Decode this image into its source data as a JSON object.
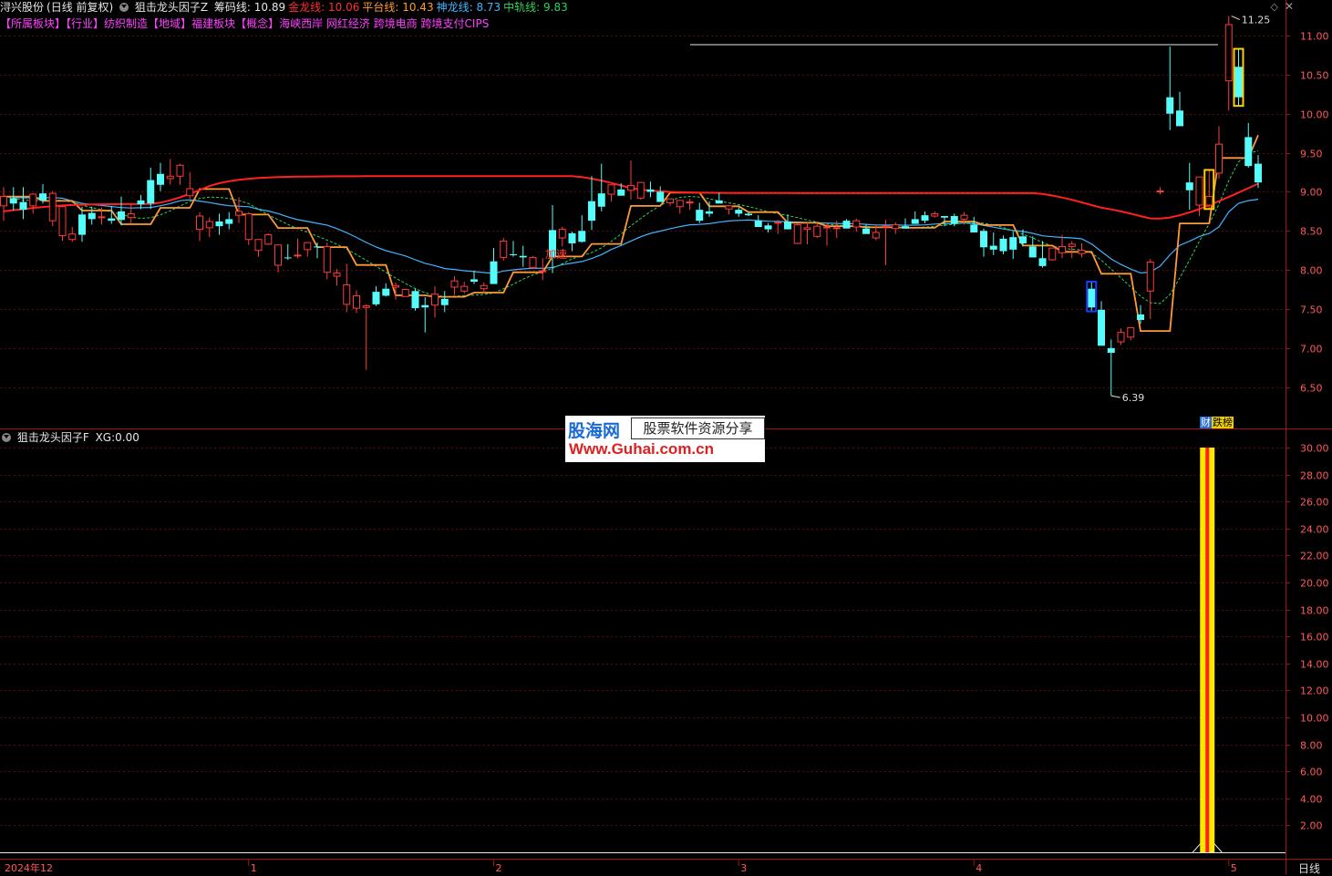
{
  "header": {
    "stock": "浔兴股份",
    "mode": "(日线 前复权)",
    "indicator": "狙击龙头因子Z",
    "lines": [
      {
        "label": "筹码线:",
        "value": "10.89",
        "color": "#e6e6e6"
      },
      {
        "label": "金龙线:",
        "value": "10.06",
        "color": "#ff3030"
      },
      {
        "label": "平台线:",
        "value": "10.43",
        "color": "#ff9a33"
      },
      {
        "label": "神龙线:",
        "value": "8.73",
        "color": "#42b4ff"
      },
      {
        "label": "中轨线:",
        "value": "9.83",
        "color": "#2fd15a"
      }
    ]
  },
  "tags": {
    "sector_tag": "【所属板块】",
    "industry_tag": "【行业】",
    "industry": "纺织制造",
    "region_tag": "【地域】",
    "region": "福建板块",
    "concept_tag": "【概念】",
    "concepts": "海峡西岸 网红经济 跨境电商 跨境支付CIPS"
  },
  "sub_indicator": {
    "name": "狙击龙头因子F",
    "label": "XG:",
    "value": "0.00"
  },
  "watermark": {
    "brand": "股海网",
    "slogan": "股票软件资源分享",
    "url": "Www.Guhai.com.cn"
  },
  "badge": {
    "a": "财",
    "b": "跌榜"
  },
  "period_label": "日线",
  "chart_data": [
    {
      "type": "candlestick",
      "yaxis": [
        6.5,
        7.0,
        7.5,
        8.0,
        8.5,
        9.0,
        9.5,
        10.0,
        10.5,
        11.0
      ],
      "ylim": [
        6.1,
        11.45
      ],
      "annotations": [
        {
          "text": "11.25",
          "value": 11.25,
          "kind": "high"
        },
        {
          "text": "6.39",
          "value": 6.39,
          "kind": "low"
        },
        {
          "text": "加速",
          "value": 8.2,
          "kind": "label"
        }
      ],
      "candles": [
        [
          8.82,
          9.06,
          8.63,
          8.94
        ],
        [
          8.92,
          9.06,
          8.76,
          8.85
        ],
        [
          8.87,
          9.06,
          8.65,
          8.77
        ],
        [
          8.82,
          8.98,
          8.72,
          8.97
        ],
        [
          8.98,
          9.1,
          8.85,
          8.89
        ],
        [
          8.63,
          9.01,
          8.56,
          8.98
        ],
        [
          8.44,
          8.67,
          8.37,
          8.81
        ],
        [
          8.39,
          8.55,
          8.36,
          8.46
        ],
        [
          8.71,
          8.81,
          8.36,
          8.45
        ],
        [
          8.73,
          8.81,
          8.58,
          8.65
        ],
        [
          8.68,
          8.8,
          8.58,
          8.68
        ],
        [
          8.66,
          8.82,
          8.59,
          8.63
        ],
        [
          8.75,
          8.94,
          8.57,
          8.64
        ],
        [
          8.67,
          8.84,
          8.6,
          8.72
        ],
        [
          8.89,
          8.96,
          8.78,
          8.84
        ],
        [
          9.15,
          9.31,
          8.78,
          8.85
        ],
        [
          9.23,
          9.37,
          9.01,
          9.09
        ],
        [
          9.17,
          9.42,
          9.09,
          9.2
        ],
        [
          9.2,
          9.36,
          9.09,
          9.34
        ],
        [
          8.95,
          9.25,
          8.91,
          9.04
        ],
        [
          8.52,
          8.74,
          8.37,
          8.69
        ],
        [
          8.54,
          8.67,
          8.42,
          8.62
        ],
        [
          8.62,
          8.72,
          8.45,
          8.56
        ],
        [
          8.65,
          8.74,
          8.52,
          8.59
        ],
        [
          8.7,
          8.93,
          8.6,
          8.75
        ],
        [
          8.39,
          8.74,
          8.32,
          8.72
        ],
        [
          8.25,
          8.38,
          8.17,
          8.39
        ],
        [
          8.33,
          8.47,
          8.32,
          8.45
        ],
        [
          8.06,
          8.31,
          7.97,
          8.32
        ],
        [
          8.16,
          8.33,
          8.13,
          8.15
        ],
        [
          8.18,
          8.4,
          8.15,
          8.19
        ],
        [
          8.26,
          8.34,
          8.17,
          8.35
        ],
        [
          8.3,
          8.35,
          8.15,
          8.29
        ],
        [
          7.97,
          8.35,
          7.88,
          8.3
        ],
        [
          7.92,
          8.01,
          7.8,
          7.96
        ],
        [
          7.56,
          8.08,
          7.46,
          7.81
        ],
        [
          7.51,
          7.74,
          7.45,
          7.67
        ],
        [
          7.52,
          7.56,
          6.72,
          7.54
        ],
        [
          7.72,
          7.79,
          7.54,
          7.56
        ],
        [
          7.76,
          7.83,
          7.66,
          7.67
        ],
        [
          7.78,
          7.84,
          7.62,
          7.8
        ],
        [
          7.66,
          7.74,
          7.66,
          7.75
        ],
        [
          7.73,
          7.76,
          7.48,
          7.51
        ],
        [
          7.55,
          7.65,
          7.2,
          7.52
        ],
        [
          7.55,
          7.79,
          7.39,
          7.69
        ],
        [
          7.63,
          7.73,
          7.46,
          7.55
        ],
        [
          7.78,
          7.92,
          7.68,
          7.86
        ],
        [
          7.73,
          7.85,
          7.7,
          7.79
        ],
        [
          7.88,
          7.99,
          7.82,
          7.85
        ],
        [
          7.76,
          7.84,
          7.7,
          7.8
        ],
        [
          8.11,
          8.28,
          7.83,
          7.82
        ],
        [
          8.16,
          8.41,
          8.12,
          8.37
        ],
        [
          8.2,
          8.37,
          8.17,
          8.19
        ],
        [
          8.18,
          8.31,
          8.04,
          8.16
        ],
        [
          8.03,
          8.18,
          8.01,
          8.16
        ],
        [
          7.98,
          8.15,
          7.87,
          7.99
        ],
        [
          8.51,
          8.83,
          7.96,
          8.16
        ],
        [
          8.41,
          8.55,
          8.3,
          8.52
        ],
        [
          8.47,
          8.49,
          8.24,
          8.34
        ],
        [
          8.5,
          8.7,
          8.35,
          8.36
        ],
        [
          8.88,
          9.2,
          8.51,
          8.63
        ],
        [
          8.98,
          9.36,
          8.75,
          8.81
        ],
        [
          8.97,
          9.08,
          8.88,
          9.09
        ],
        [
          9.03,
          9.11,
          8.96,
          8.95
        ],
        [
          9.02,
          9.4,
          8.9,
          9.08
        ],
        [
          8.92,
          9.09,
          8.9,
          9.12
        ],
        [
          9.03,
          9.13,
          8.93,
          9.0
        ],
        [
          9.0,
          9.07,
          8.88,
          8.87
        ],
        [
          8.86,
          8.91,
          8.82,
          8.91
        ],
        [
          8.81,
          8.87,
          8.72,
          8.89
        ],
        [
          8.86,
          8.91,
          8.77,
          8.87
        ],
        [
          8.77,
          8.86,
          8.6,
          8.63
        ],
        [
          8.75,
          8.88,
          8.68,
          8.72
        ],
        [
          8.89,
          8.99,
          8.86,
          8.85
        ],
        [
          8.78,
          8.83,
          8.71,
          8.82
        ],
        [
          8.77,
          8.8,
          8.68,
          8.72
        ],
        [
          8.72,
          8.74,
          8.69,
          8.7
        ],
        [
          8.63,
          8.7,
          8.57,
          8.55
        ],
        [
          8.57,
          8.6,
          8.48,
          8.52
        ],
        [
          8.6,
          8.64,
          8.46,
          8.61
        ],
        [
          8.62,
          8.71,
          8.6,
          8.52
        ],
        [
          8.34,
          8.6,
          8.33,
          8.58
        ],
        [
          8.52,
          8.62,
          8.33,
          8.54
        ],
        [
          8.43,
          8.6,
          8.41,
          8.56
        ],
        [
          8.55,
          8.61,
          8.31,
          8.55
        ],
        [
          8.53,
          8.63,
          8.41,
          8.54
        ],
        [
          8.63,
          8.65,
          8.57,
          8.53
        ],
        [
          8.55,
          8.66,
          8.49,
          8.63
        ],
        [
          8.53,
          8.58,
          8.51,
          8.46
        ],
        [
          8.41,
          8.58,
          8.38,
          8.48
        ],
        [
          8.56,
          8.64,
          8.06,
          8.56
        ],
        [
          8.53,
          8.61,
          8.46,
          8.58
        ],
        [
          8.56,
          8.66,
          8.55,
          8.53
        ],
        [
          8.65,
          8.75,
          8.64,
          8.59
        ],
        [
          8.7,
          8.75,
          8.6,
          8.63
        ],
        [
          8.69,
          8.75,
          8.67,
          8.72
        ],
        [
          8.69,
          8.69,
          8.56,
          8.67
        ],
        [
          8.69,
          8.72,
          8.56,
          8.59
        ],
        [
          8.65,
          8.74,
          8.58,
          8.7
        ],
        [
          8.58,
          8.68,
          8.48,
          8.48
        ],
        [
          8.5,
          8.53,
          8.17,
          8.29
        ],
        [
          8.31,
          8.48,
          8.19,
          8.26
        ],
        [
          8.4,
          8.44,
          8.2,
          8.24
        ],
        [
          8.42,
          8.49,
          8.14,
          8.26
        ],
        [
          8.43,
          8.52,
          8.3,
          8.34
        ],
        [
          8.3,
          8.43,
          8.19,
          8.16
        ],
        [
          8.15,
          8.37,
          8.03,
          8.05
        ],
        [
          8.13,
          8.27,
          8.12,
          8.28
        ],
        [
          8.22,
          8.45,
          8.15,
          8.3
        ],
        [
          8.3,
          8.37,
          8.15,
          8.33
        ],
        [
          8.21,
          8.34,
          8.16,
          8.25
        ],
        [
          7.76,
          7.85,
          7.47,
          7.52
        ],
        [
          7.49,
          7.6,
          7.22,
          7.03
        ],
        [
          7.0,
          7.11,
          6.39,
          6.94
        ],
        [
          7.08,
          7.25,
          7.04,
          7.2
        ],
        [
          7.14,
          7.26,
          7.1,
          7.26
        ],
        [
          7.43,
          7.55,
          7.31,
          7.36
        ],
        [
          7.73,
          8.14,
          7.37,
          8.1
        ],
        [
          9.0,
          9.06,
          8.97,
          9.01
        ],
        [
          10.21,
          10.86,
          9.79,
          10.0
        ],
        [
          10.04,
          10.28,
          10.0,
          9.84
        ],
        [
          9.12,
          9.37,
          8.77,
          9.02
        ],
        [
          8.83,
          9.13,
          8.69,
          9.19
        ],
        [
          8.83,
          9.28,
          8.78,
          8.94
        ],
        [
          9.24,
          9.84,
          9.17,
          9.61
        ],
        [
          10.42,
          11.25,
          10.04,
          11.14
        ],
        [
          10.6,
          10.83,
          10.1,
          10.21
        ],
        [
          9.7,
          9.88,
          9.31,
          9.33
        ],
        [
          9.36,
          9.47,
          9.05,
          9.12
        ]
      ],
      "lines": {
        "golden": "red line (金龙线)",
        "platform": "orange step line (平台线)",
        "dragon": "blue smooth line (神龙线)",
        "mid": "green dashed line (中轨线)"
      }
    },
    {
      "type": "bar",
      "yaxis": [
        2,
        4,
        6,
        8,
        10,
        12,
        14,
        16,
        18,
        20,
        22,
        24,
        26,
        28,
        30
      ],
      "ylim": [
        0,
        31
      ],
      "signal_index": 123,
      "signal_value": 30,
      "xticks": [
        {
          "label": "2024年12",
          "index": 0
        },
        {
          "label": "1",
          "index": 25
        },
        {
          "label": "2",
          "index": 50
        },
        {
          "label": "3",
          "index": 75
        },
        {
          "label": "4",
          "index": 99
        },
        {
          "label": "5",
          "index": 125
        }
      ]
    }
  ]
}
